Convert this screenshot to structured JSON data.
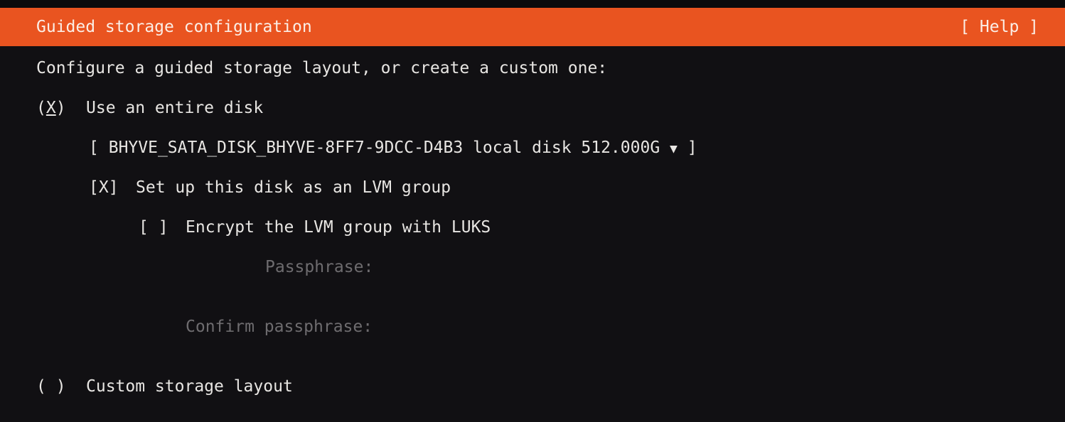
{
  "header": {
    "title": "Guided storage configuration",
    "help": "[ Help ]"
  },
  "intro": "Configure a guided storage layout, or create a custom one:",
  "entire_disk": {
    "radio_open": "(",
    "radio_mark": "X",
    "radio_close": ")",
    "label": "Use an entire disk",
    "selected": true
  },
  "disk_select": {
    "open": "[",
    "value": "BHYVE_SATA_DISK_BHYVE-8FF7-9DCC-D4B3 local disk 512.000G",
    "arrow": "▼",
    "close": "]"
  },
  "lvm": {
    "checkbox": "[X]",
    "label": "Set up this disk as an LVM group",
    "checked": true
  },
  "luks": {
    "checkbox": "[ ]",
    "label": "Encrypt the LVM group with LUKS",
    "checked": false
  },
  "passphrase_label": "Passphrase:",
  "confirm_label": "Confirm passphrase:",
  "custom": {
    "radio": "( )",
    "label": "Custom storage layout",
    "selected": false
  },
  "colors": {
    "accent": "#E95420",
    "background": "#111013"
  }
}
